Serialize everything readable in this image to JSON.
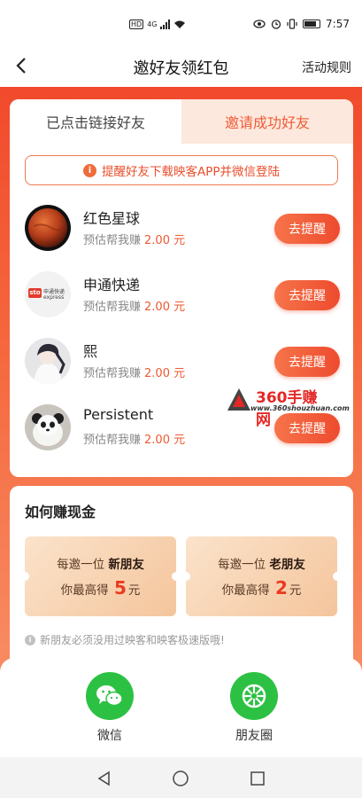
{
  "status_bar": {
    "hd": "HD",
    "network": "4G",
    "time": "7:57"
  },
  "header": {
    "title": "邀好友领红包",
    "rules_link": "活动规则"
  },
  "tabs": [
    {
      "label": "已点击链接好友",
      "active": false
    },
    {
      "label": "邀请成功好友",
      "active": true
    }
  ],
  "remind_banner": {
    "icon_text": "i",
    "text": "提醒好友下载映客APP并微信登陆"
  },
  "friends": [
    {
      "name": "红色星球",
      "earn_label": "预估帮我赚",
      "amount": "2.00 元",
      "button": "去提醒",
      "avatar": "red-planet"
    },
    {
      "name": "申通快递",
      "earn_label": "预估帮我赚",
      "amount": "2.00 元",
      "button": "去提醒",
      "avatar": "sto-express",
      "avatar_text_en": "sto",
      "avatar_text_cn": "申通快递",
      "avatar_text_sub": "express"
    },
    {
      "name": "熙",
      "earn_label": "预估帮我赚",
      "amount": "2.00 元",
      "button": "去提醒",
      "avatar": "anime-person"
    },
    {
      "name": "Persistent",
      "earn_label": "预估帮我赚",
      "amount": "2.00 元",
      "button": "去提醒",
      "avatar": "panda-bear"
    }
  ],
  "watermark": {
    "text": "360手赚网",
    "url": "www.360shouzhuan.com"
  },
  "how_to_earn": {
    "title": "如何赚现金",
    "new_friend": {
      "prefix": "每邀一位",
      "type": "新朋友",
      "reward_prefix": "你最高得",
      "amount": "5",
      "unit": "元"
    },
    "old_friend": {
      "prefix": "每邀一位",
      "type": "老朋友",
      "reward_prefix": "你最高得",
      "amount": "2",
      "unit": "元"
    },
    "note_icon": "i",
    "note": "新朋友必须没用过映客和映客极速版哦!"
  },
  "share": [
    {
      "label": "微信",
      "icon": "wechat-icon",
      "color": "#2dc144"
    },
    {
      "label": "朋友圈",
      "icon": "moments-icon",
      "color": "#2dc144"
    }
  ],
  "colors": {
    "accent": "#ee4b2e",
    "background_top": "#f14a2c",
    "tab_active_bg": "#fde8dd"
  }
}
